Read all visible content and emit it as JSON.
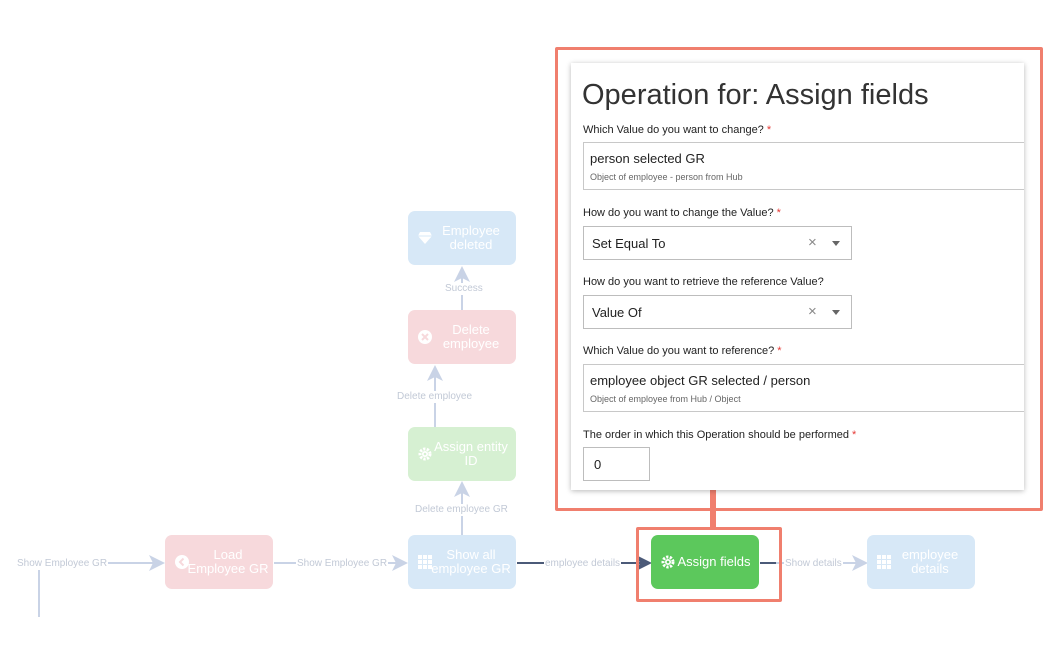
{
  "flow": {
    "nodes": {
      "employee_deleted": "Employee deleted",
      "delete_employee": "Delete employee",
      "assign_entity_id": "Assign entity ID",
      "load_employee_gr": "Load Employee GR",
      "show_all_employee_gr": "Show all employee GR",
      "assign_fields": "Assign fields",
      "employee_details": "employee details"
    },
    "edges": {
      "success": "Success",
      "delete_employee": "Delete employee",
      "delete_employee_gr": "Delete employee GR",
      "show_employee_gr_1": "Show Employee GR",
      "show_employee_gr_2": "Show Employee GR",
      "employee_details": "employee details",
      "show_details": "Show details"
    },
    "colors": {
      "highlight": "#f07f6e",
      "active_node": "#5cc85c",
      "pink_node": "#f7d9dc",
      "blue_node": "#d7e8f7",
      "green_node": "#d6f0d2"
    }
  },
  "panel": {
    "title": "Operation for: Assign fields",
    "field1": {
      "label": "Which Value do you want to change?",
      "required": "*",
      "value": "person selected GR",
      "sub": "Object of employee - person from Hub"
    },
    "field2": {
      "label": "How do you want to change the Value?",
      "required": "*",
      "value": "Set Equal To",
      "clear": "×"
    },
    "field3": {
      "label": "How do you want to retrieve the reference Value?",
      "value": "Value Of",
      "clear": "×"
    },
    "field4": {
      "label": "Which Value do you want to reference?",
      "required": "*",
      "value": "employee object GR selected / person",
      "sub": "Object of employee from Hub / Object"
    },
    "field5": {
      "label": "The order in which this Operation should be performed",
      "required": "*",
      "value": "0"
    }
  }
}
